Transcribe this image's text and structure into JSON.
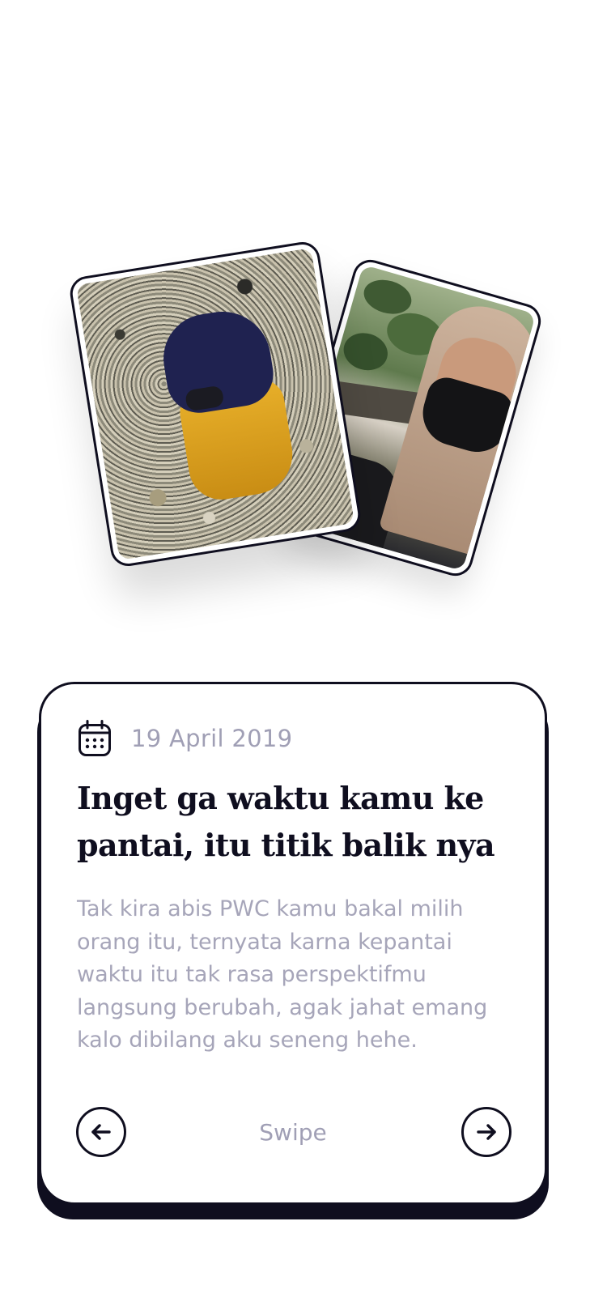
{
  "photos": [
    {
      "subject": "person in navy hijab and yellow skirt kneeling on beach gravel"
    },
    {
      "subject": "selfie of person in beige hijab wearing black face mask"
    }
  ],
  "card": {
    "date": "19 April 2019",
    "title": "Inget ga waktu kamu ke pantai, itu titik balik nya",
    "body": "Tak kira abis PWC kamu bakal milih orang itu, ternyata karna kepantai waktu itu tak rasa perspektifmu langsung berubah, agak jahat emang kalo dibilang aku seneng hehe.",
    "swipe_label": "Swipe",
    "icons": {
      "date": "calendar-icon",
      "prev": "arrow-left-icon",
      "next": "arrow-right-icon"
    }
  },
  "colors": {
    "ink": "#0f0e1f",
    "muted_text": "#a09fb5",
    "background": "#ffffff"
  }
}
